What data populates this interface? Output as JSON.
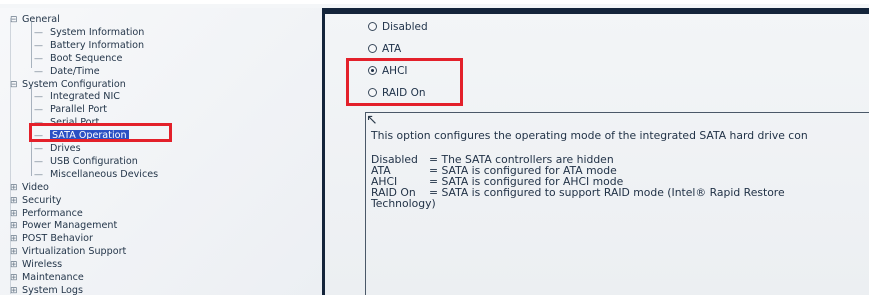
{
  "tree": {
    "items": [
      {
        "label": "General",
        "glyph": "⊟",
        "level": 0
      },
      {
        "label": "System Information",
        "level": 1
      },
      {
        "label": "Battery Information",
        "level": 1
      },
      {
        "label": "Boot Sequence",
        "level": 1
      },
      {
        "label": "Date/Time",
        "level": 1
      },
      {
        "label": "System Configuration",
        "glyph": "⊟",
        "level": 0
      },
      {
        "label": "Integrated NIC",
        "level": 1
      },
      {
        "label": "Parallel Port",
        "level": 1
      },
      {
        "label": "Serial Port",
        "level": 1
      },
      {
        "label": "SATA Operation",
        "level": 1,
        "selected": true
      },
      {
        "label": "Drives",
        "level": 1
      },
      {
        "label": "USB Configuration",
        "level": 1
      },
      {
        "label": "Miscellaneous Devices",
        "level": 1
      },
      {
        "label": "Video",
        "glyph": "⊞",
        "level": 0
      },
      {
        "label": "Security",
        "glyph": "⊞",
        "level": 0
      },
      {
        "label": "Performance",
        "glyph": "⊞",
        "level": 0
      },
      {
        "label": "Power Management",
        "glyph": "⊞",
        "level": 0
      },
      {
        "label": "POST Behavior",
        "glyph": "⊞",
        "level": 0
      },
      {
        "label": "Virtualization Support",
        "glyph": "⊞",
        "level": 0
      },
      {
        "label": "Wireless",
        "glyph": "⊞",
        "level": 0
      },
      {
        "label": "Maintenance",
        "glyph": "⊞",
        "level": 0
      },
      {
        "label": "System Logs",
        "glyph": "⊞",
        "level": 0
      }
    ]
  },
  "options": {
    "selected": "AHCI",
    "items": [
      "Disabled",
      "ATA",
      "AHCI",
      "RAID On"
    ]
  },
  "help": {
    "intro": "This option configures the operating mode of the integrated SATA hard drive con",
    "definitions": [
      {
        "key": "Disabled",
        "value": "= The SATA controllers are hidden"
      },
      {
        "key": "ATA",
        "value": "= SATA is configured for ATA mode"
      },
      {
        "key": "AHCI",
        "value": "= SATA is configured for AHCI mode"
      },
      {
        "key": "RAID On",
        "value": "= SATA is configured to support RAID mode (Intel® Rapid Restore"
      },
      {
        "key": "Technology)",
        "value": ""
      }
    ]
  },
  "colors": {
    "highlight": "#e3202a",
    "selection": "#2b50c4",
    "divider": "#14243a"
  }
}
